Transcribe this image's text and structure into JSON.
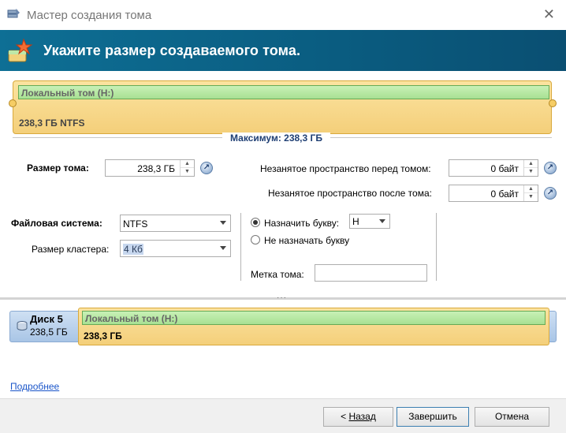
{
  "window": {
    "title": "Мастер создания тома",
    "close_glyph": "✕"
  },
  "banner": {
    "heading": "Укажите размер создаваемого тома."
  },
  "preview": {
    "volume_name": "Локальный том (H:)",
    "volume_info": "238,3 ГБ NTFS",
    "maximum_label": "Максимум: 238,3 ГБ"
  },
  "form": {
    "volume_size_label": "Размер тома:",
    "volume_size_value": "238,3 ГБ",
    "space_before_label": "Незанятое пространство перед томом:",
    "space_before_value": "0 байт",
    "space_after_label": "Незанятое пространство после тома:",
    "space_after_value": "0 байт",
    "filesystem_label": "Файловая система:",
    "filesystem_value": "NTFS",
    "cluster_label": "Размер кластера:",
    "cluster_value": "4 Кб",
    "assign_letter_label": "Назначить букву:",
    "assign_letter_value": "H",
    "no_letter_label": "Не назначать букву",
    "volume_label_label": "Метка тома:",
    "volume_label_value": ""
  },
  "disk": {
    "name": "Диск 5",
    "size": "238,5 ГБ",
    "volume_name": "Локальный том (H:)",
    "volume_size": "238,3 ГБ"
  },
  "links": {
    "more": "Подробнее"
  },
  "buttons": {
    "back_prefix": "< ",
    "back_label": "Назад",
    "finish_label": "Завершить",
    "cancel_label": "Отмена"
  },
  "colors": {
    "banner": "#0e6f95",
    "volume_fill": "#f4cf7a",
    "volume_name_fill": "#a8e093",
    "max_label": "#1f3f74",
    "link": "#1a55c9"
  }
}
